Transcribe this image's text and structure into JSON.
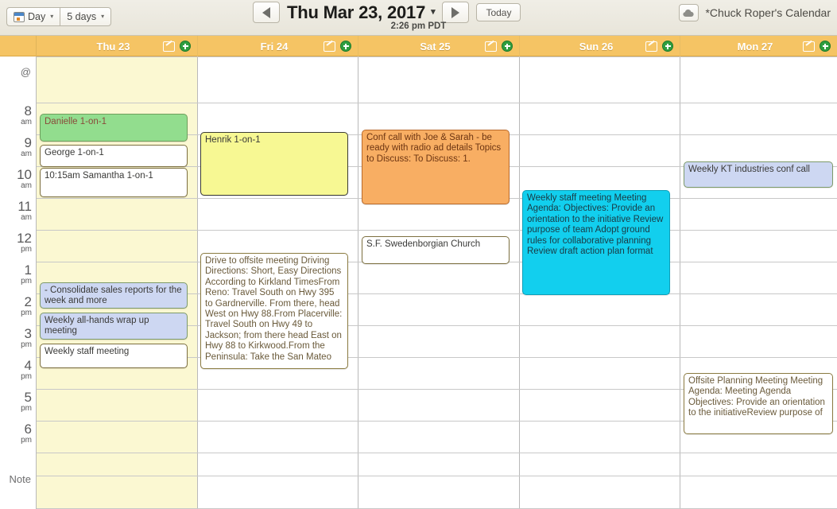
{
  "toolbar": {
    "view_day_label": "Day",
    "view_range_label": "5 days",
    "prev_label": "◀",
    "next_label": "▶",
    "date_title": "Thu Mar 23, 2017",
    "date_caret": "▾",
    "today_label": "Today",
    "timezone": "2:26 pm PDT",
    "account_name": "*Chuck Roper's Calendar",
    "icons": {
      "mini_calendar": "calendar-icon",
      "cloud": "cloud-icon",
      "caret": "chevron-down-icon",
      "prev": "chevron-left-icon",
      "next": "chevron-right-icon"
    }
  },
  "day_headers": [
    {
      "label": "Thu 23",
      "edit_icon": "edit-note-icon",
      "add_icon": "add-event-icon"
    },
    {
      "label": "Fri 24",
      "edit_icon": "edit-note-icon",
      "add_icon": "add-event-icon"
    },
    {
      "label": "Sat 25",
      "edit_icon": "edit-note-icon",
      "add_icon": "add-event-icon"
    },
    {
      "label": "Sun 26",
      "edit_icon": "edit-note-icon",
      "add_icon": "add-event-icon"
    },
    {
      "label": "Mon 27",
      "edit_icon": "edit-note-icon",
      "add_icon": "add-event-icon"
    }
  ],
  "time_gutter": {
    "all_day_label": "@",
    "note_label": "Note",
    "hours": [
      {
        "num": "8",
        "suffix": "am"
      },
      {
        "num": "9",
        "suffix": "am"
      },
      {
        "num": "10",
        "suffix": "am"
      },
      {
        "num": "11",
        "suffix": "am"
      },
      {
        "num": "12",
        "suffix": "pm"
      },
      {
        "num": "1",
        "suffix": "pm"
      },
      {
        "num": "2",
        "suffix": "pm"
      },
      {
        "num": "3",
        "suffix": "pm"
      },
      {
        "num": "4",
        "suffix": "pm"
      },
      {
        "num": "5",
        "suffix": "pm"
      },
      {
        "num": "6",
        "suffix": "pm"
      }
    ]
  },
  "events": {
    "thu": [
      {
        "title": "Danielle 1-on-1"
      },
      {
        "title": "George 1-on-1"
      },
      {
        "title": "10:15am Samantha 1-on-1"
      },
      {
        "title": "- Consolidate sales reports for the week and more"
      },
      {
        "title": "Weekly all-hands wrap up meeting"
      },
      {
        "title": "Weekly staff meeting"
      }
    ],
    "fri": [
      {
        "title": "Henrik 1-on-1"
      },
      {
        "title": "Drive to offsite meeting Driving Directions: Short, Easy Directions According to Kirkland TimesFrom Reno: Travel South on Hwy 395 to Gardnerville. From there, head West on Hwy 88.From Placerville: Travel South on Hwy 49 to Jackson; from there head East on Hwy 88 to Kirkwood.From the Peninsula: Take the San Mateo"
      }
    ],
    "sat": [
      {
        "title": "Conf call with Joe & Sarah - be ready with radio ad details Topics to Discuss: To Discuss: 1."
      },
      {
        "title": "S.F. Swedenborgian Church"
      }
    ],
    "sun": [
      {
        "title": "Weekly staff meeting Meeting Agenda: Objectives: Provide an orientation to the initiative Review purpose of team Adopt ground rules for collaborative planning Review draft action plan format"
      }
    ],
    "mon": [
      {
        "title": "Weekly KT industries conf call"
      },
      {
        "title": "Offsite Planning Meeting Meeting Agenda: Meeting Agenda Objectives: Provide an orientation to the initiativeReview purpose of"
      }
    ]
  },
  "colors": {
    "day_header_bg": "#f5c464",
    "today_column_bg": "#fbf8d2",
    "event_green": "#92dd8e",
    "event_lavender": "#cdd7f2",
    "event_yellow": "#f7f893",
    "event_orange": "#f8ae63",
    "event_cyan": "#12cfee",
    "add_icon_green": "#2f9e3f"
  }
}
